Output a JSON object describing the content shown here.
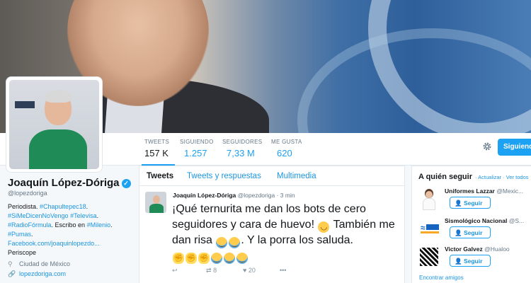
{
  "profile": {
    "name": "Joaquín López-Dóriga",
    "handle": "@lopezdoriga",
    "bio_lines": [
      [
        {
          "t": "Periodista. ",
          "link": false
        },
        {
          "t": "#Chapultepec18",
          "link": true
        },
        {
          "t": ".",
          "link": false
        }
      ],
      [
        {
          "t": "#SiMeDicenNoVengo",
          "link": true
        },
        {
          "t": " ",
          "link": false
        },
        {
          "t": "#Televisa",
          "link": true
        },
        {
          "t": ".",
          "link": false
        }
      ],
      [
        {
          "t": "#RadioFórmula",
          "link": true
        },
        {
          "t": ". Escribo en ",
          "link": false
        },
        {
          "t": "#Milenio",
          "link": true
        },
        {
          "t": ".",
          "link": false
        }
      ],
      [
        {
          "t": "#Pumas",
          "link": true
        },
        {
          "t": ".",
          "link": false
        }
      ],
      [
        {
          "t": "Facebook.com/joaquinlopezdo...",
          "link": true
        }
      ],
      [
        {
          "t": "Periscope",
          "link": false
        }
      ]
    ],
    "location": "Ciudad de México",
    "website": "lopezdoriga.com"
  },
  "stats": [
    {
      "label": "TWEETS",
      "value": "157 K"
    },
    {
      "label": "SIGUIENDO",
      "value": "1.257"
    },
    {
      "label": "SEGUIDORES",
      "value": "7,33 M"
    },
    {
      "label": "ME GUSTA",
      "value": "620"
    }
  ],
  "follow_button": "Siguiendo",
  "tabs": [
    "Tweets",
    "Tweets y respuestas",
    "Multimedia"
  ],
  "tweet": {
    "author": "Joaquín López-Dóriga",
    "handle": "@lopezdoriga",
    "time": "3 min",
    "text_a": "¡Qué ternurita me dan los bots de cero seguidores y cara de huevo!",
    "text_b": "También me dan risa",
    "text_c": ". Y la porra los saluda.",
    "emoji_icons": [
      "smirk-emoji",
      "joy-emoji",
      "fist-emoji"
    ],
    "retweets": "8",
    "likes": "20"
  },
  "who_to_follow": {
    "title": "A quién seguir",
    "refresh": "Actualizar",
    "view_all": "Ver todos",
    "separator": "·",
    "items": [
      {
        "name": "Uniformes Lazzar",
        "handle": "@Mexic...",
        "button": "Seguir"
      },
      {
        "name": "Sismológico Nacional",
        "handle": "@S...",
        "button": "Seguir"
      },
      {
        "name": "Victor Galvez",
        "handle": "@Hualoo",
        "button": "Seguir"
      }
    ],
    "find_friends": "Encontrar amigos"
  },
  "colors": {
    "accent": "#1da1f2",
    "link": "#1b95e0",
    "text": "#14171a",
    "muted": "#657786"
  }
}
